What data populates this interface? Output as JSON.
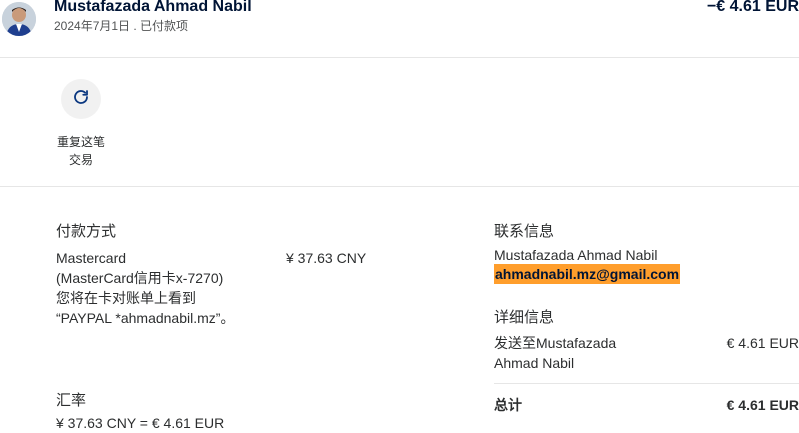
{
  "transaction": {
    "name": "Mustafazada Ahmad Nabil",
    "subtitle": "2024年7月1日 . 已付款项",
    "amount": "−€ 4.61 EUR"
  },
  "actions": {
    "repeat_label": "重复这笔\n交易",
    "repeat_icon": "refresh-icon"
  },
  "payment": {
    "heading": "付款方式",
    "method_text": "Mastercard\n(MasterCard信用卡x-7270)\n您将在卡对账单上看到\n“PAYPAL *ahmadnabil.mz”。",
    "amount": "¥ 37.63 CNY"
  },
  "exchange": {
    "heading": "汇率",
    "rate": "¥ 37.63 CNY = € 4.61 EUR"
  },
  "contact": {
    "heading": "联系信息",
    "name": "Mustafazada Ahmad Nabil",
    "email": "ahmadnabil.mz@gmail.com",
    "email_highlight": "#ff9e2c"
  },
  "details": {
    "heading": "详细信息",
    "sent_to": "发送至Mustafazada\nAhmad Nabil",
    "sent_amount": "€ 4.61 EUR",
    "total_label": "总计",
    "total_amount": "€ 4.61 EUR"
  }
}
